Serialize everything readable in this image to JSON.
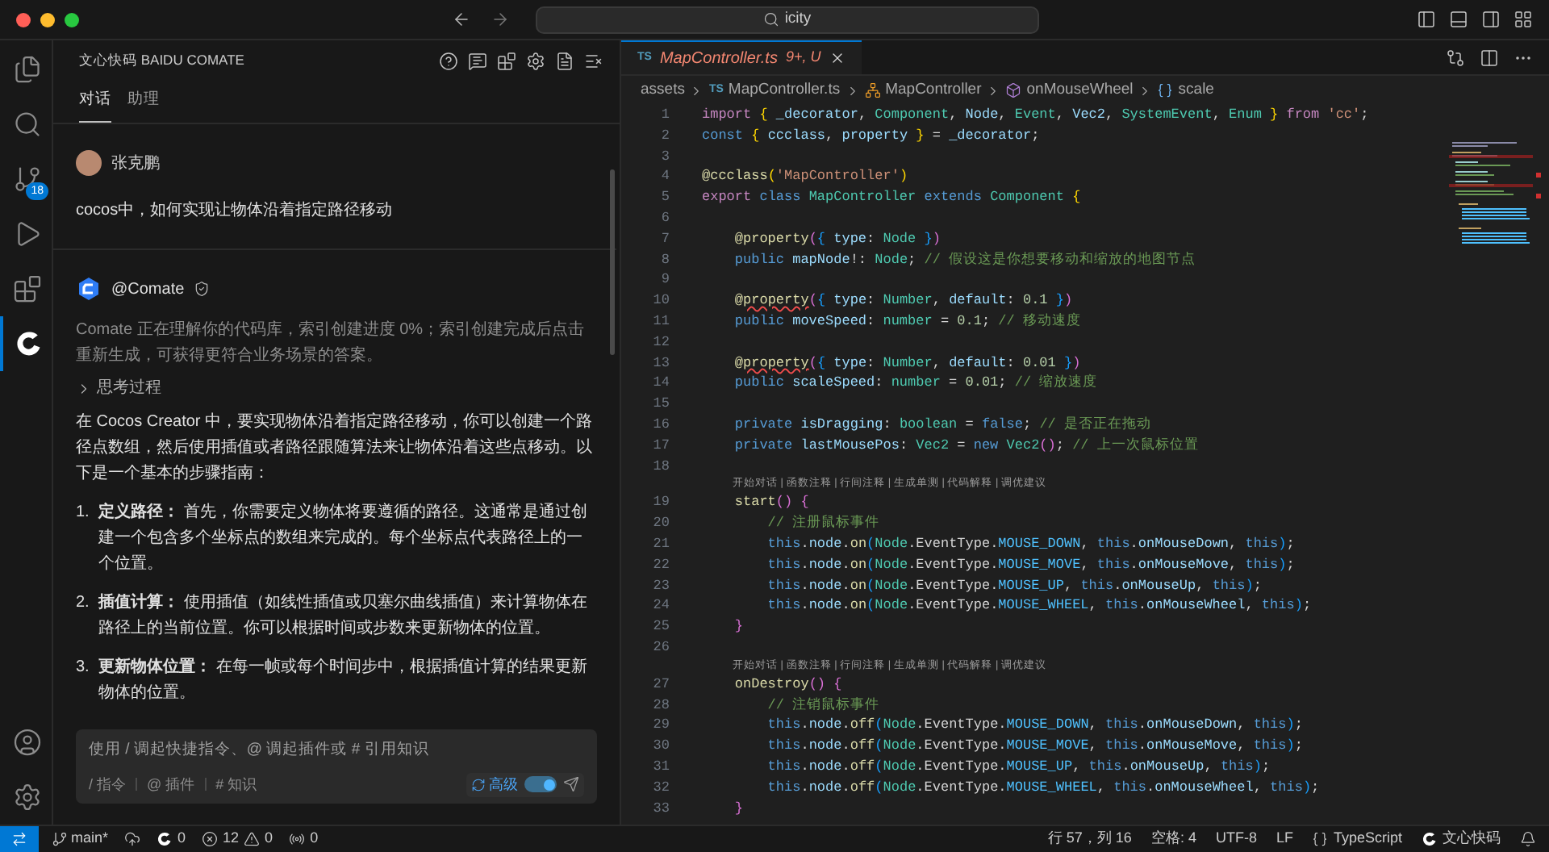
{
  "title_bar": {
    "search": "icity"
  },
  "activity_bar": [
    {
      "kind": "files",
      "selected": false
    },
    {
      "kind": "search",
      "selected": false
    },
    {
      "kind": "source-control",
      "selected": false,
      "badge": "18"
    },
    {
      "kind": "debug",
      "selected": false
    },
    {
      "kind": "extensions",
      "selected": false
    },
    {
      "kind": "comate",
      "selected": true
    }
  ],
  "activity_bottom": [
    {
      "kind": "account"
    },
    {
      "kind": "settings"
    }
  ],
  "chat": {
    "title": "文心快码 BAIDU COMATE",
    "tabs": [
      {
        "label": "对话",
        "selected": true
      },
      {
        "label": "助理",
        "selected": false
      }
    ],
    "user": {
      "name": "张克鹏",
      "message": "cocos中，如何实现让物体沿着指定路径移动"
    },
    "bot": {
      "name": "@Comate",
      "notice": "Comate 正在理解你的代码库，索引创建进度 0%；索引创建完成后点击重新生成，可获得更符合业务场景的答案。",
      "thinking": {
        "label": "思考过程",
        "expanded": false
      },
      "intro": "在 Cocos Creator 中，要实现物体沿着指定路径移动，你可以创建一个路径点数组，然后使用插值或者路径跟随算法来让物体沿着这些点移动。以下是一个基本的步骤指南：",
      "steps": [
        {
          "number": "1.",
          "text": "**定义路径：** 首先，你需要定义物体将要遵循的路径。这通常是通过创建一个包含多个坐标点的数组来完成的。每个坐标点代表路径上的一个位置。"
        },
        {
          "number": "2.",
          "text": "**插值计算：** 使用插值（如线性插值或贝塞尔曲线插值）来计算物体在路径上的当前位置。你可以根据时间或步数来更新物体的位置。"
        },
        {
          "number": "3.",
          "text": "**更新物体位置：** 在每一帧或每个时间步中，根据插值计算的结果更新物体的位置。"
        }
      ]
    },
    "input": {
      "placeholder": "使用 / 调起快捷指令、@ 调起插件或 # 引用知识",
      "chips": [
        "/ 指令",
        "@ 插件",
        "# 知识"
      ],
      "advanced": {
        "label": "高级",
        "on": true
      }
    }
  },
  "editor": {
    "tab": {
      "lang": "TS",
      "name": "MapController.ts",
      "status": "9+, U"
    },
    "breadcrumbs": [
      {
        "kind": "folder",
        "label": "assets"
      },
      {
        "kind": "file",
        "icon": "TS",
        "label": "MapController.ts"
      },
      {
        "kind": "class",
        "label": "MapController"
      },
      {
        "kind": "method",
        "label": "onMouseWheel"
      },
      {
        "kind": "variable",
        "label": "scale"
      }
    ],
    "lines": [
      {
        "kind": "code",
        "number": "1",
        "tokens": [
          {
            "kind": "control",
            "text": "import "
          },
          {
            "kind": "bracket1",
            "text": "{ "
          },
          {
            "kind": "variable",
            "text": "_decorator"
          },
          {
            "kind": "plain",
            "text": ", "
          },
          {
            "kind": "type",
            "text": "Component"
          },
          {
            "kind": "plain",
            "text": ", "
          },
          {
            "kind": "variable",
            "text": "Node"
          },
          {
            "kind": "plain",
            "text": ", "
          },
          {
            "kind": "type",
            "text": "Event"
          },
          {
            "kind": "plain",
            "text": ", "
          },
          {
            "kind": "variable",
            "text": "Vec2"
          },
          {
            "kind": "plain",
            "text": ", "
          },
          {
            "kind": "type",
            "text": "SystemEvent"
          },
          {
            "kind": "plain",
            "text": ", "
          },
          {
            "kind": "type",
            "text": "Enum"
          },
          {
            "kind": "bracket1",
            "text": " }"
          },
          {
            "kind": "control",
            "text": " from "
          },
          {
            "kind": "string",
            "text": "'cc'"
          },
          {
            "kind": "plain",
            "text": ";"
          }
        ]
      },
      {
        "kind": "code",
        "number": "2",
        "tokens": [
          {
            "kind": "keyword",
            "text": "const "
          },
          {
            "kind": "bracket1",
            "text": "{ "
          },
          {
            "kind": "variable",
            "text": "ccclass"
          },
          {
            "kind": "plain",
            "text": ", "
          },
          {
            "kind": "variable",
            "text": "property"
          },
          {
            "kind": "bracket1",
            "text": " }"
          },
          {
            "kind": "plain",
            "text": " = "
          },
          {
            "kind": "variable",
            "text": "_decorator"
          },
          {
            "kind": "plain",
            "text": ";"
          }
        ]
      },
      {
        "kind": "code",
        "number": "3"
      },
      {
        "kind": "code",
        "number": "4",
        "tokens": [
          {
            "kind": "function",
            "text": "@ccclass"
          },
          {
            "kind": "bracket1",
            "text": "("
          },
          {
            "kind": "string",
            "text": "'MapController'"
          },
          {
            "kind": "bracket1",
            "text": ")"
          }
        ]
      },
      {
        "kind": "code",
        "number": "5",
        "tokens": [
          {
            "kind": "control",
            "text": "export "
          },
          {
            "kind": "keyword",
            "text": "class "
          },
          {
            "kind": "type",
            "text": "MapController "
          },
          {
            "kind": "keyword",
            "text": "extends "
          },
          {
            "kind": "type",
            "text": "Component "
          },
          {
            "kind": "bracket1",
            "text": "{"
          }
        ]
      },
      {
        "kind": "code",
        "number": "6"
      },
      {
        "kind": "code",
        "number": "7",
        "tokens": [
          {
            "kind": "function",
            "text": "    @property"
          },
          {
            "kind": "bracket2",
            "text": "("
          },
          {
            "kind": "bracket3",
            "text": "{ "
          },
          {
            "kind": "variable",
            "text": "type"
          },
          {
            "kind": "plain",
            "text": ": "
          },
          {
            "kind": "type",
            "text": "Node"
          },
          {
            "kind": "bracket3",
            "text": " }"
          },
          {
            "kind": "bracket2",
            "text": ")"
          }
        ]
      },
      {
        "kind": "code",
        "number": "8",
        "tokens": [
          {
            "kind": "keyword",
            "text": "    public "
          },
          {
            "kind": "variable",
            "text": "mapNode"
          },
          {
            "kind": "plain",
            "text": "!: "
          },
          {
            "kind": "type",
            "text": "Node"
          },
          {
            "kind": "plain",
            "text": "; "
          },
          {
            "kind": "comment",
            "text": "// 假设这是你想要移动和缩放的地图节点"
          }
        ]
      },
      {
        "kind": "code",
        "number": "9"
      },
      {
        "kind": "code",
        "number": "10",
        "tokens": [
          {
            "kind": "function",
            "text": "    @"
          },
          {
            "kind": "function-error",
            "text": "property"
          },
          {
            "kind": "bracket2",
            "text": "("
          },
          {
            "kind": "bracket3",
            "text": "{ "
          },
          {
            "kind": "variable",
            "text": "type"
          },
          {
            "kind": "plain",
            "text": ": "
          },
          {
            "kind": "type",
            "text": "Number"
          },
          {
            "kind": "plain",
            "text": ", "
          },
          {
            "kind": "variable",
            "text": "default"
          },
          {
            "kind": "plain",
            "text": ": "
          },
          {
            "kind": "number",
            "text": "0.1"
          },
          {
            "kind": "bracket3",
            "text": " }"
          },
          {
            "kind": "bracket2",
            "text": ")"
          }
        ]
      },
      {
        "kind": "code",
        "number": "11",
        "tokens": [
          {
            "kind": "keyword",
            "text": "    public "
          },
          {
            "kind": "variable",
            "text": "moveSpeed"
          },
          {
            "kind": "plain",
            "text": ": "
          },
          {
            "kind": "type",
            "text": "number"
          },
          {
            "kind": "plain",
            "text": " = "
          },
          {
            "kind": "number",
            "text": "0.1"
          },
          {
            "kind": "plain",
            "text": "; "
          },
          {
            "kind": "comment",
            "text": "// 移动速度"
          }
        ]
      },
      {
        "kind": "code",
        "number": "12"
      },
      {
        "kind": "code",
        "number": "13",
        "tokens": [
          {
            "kind": "function",
            "text": "    @"
          },
          {
            "kind": "function-error",
            "text": "property"
          },
          {
            "kind": "bracket2",
            "text": "("
          },
          {
            "kind": "bracket3",
            "text": "{ "
          },
          {
            "kind": "variable",
            "text": "type"
          },
          {
            "kind": "plain",
            "text": ": "
          },
          {
            "kind": "type",
            "text": "Number"
          },
          {
            "kind": "plain",
            "text": ", "
          },
          {
            "kind": "variable",
            "text": "default"
          },
          {
            "kind": "plain",
            "text": ": "
          },
          {
            "kind": "number",
            "text": "0.01"
          },
          {
            "kind": "bracket3",
            "text": " }"
          },
          {
            "kind": "bracket2",
            "text": ")"
          }
        ]
      },
      {
        "kind": "code",
        "number": "14",
        "tokens": [
          {
            "kind": "keyword",
            "text": "    public "
          },
          {
            "kind": "variable",
            "text": "scaleSpeed"
          },
          {
            "kind": "plain",
            "text": ": "
          },
          {
            "kind": "type",
            "text": "number"
          },
          {
            "kind": "plain",
            "text": " = "
          },
          {
            "kind": "number",
            "text": "0.01"
          },
          {
            "kind": "plain",
            "text": "; "
          },
          {
            "kind": "comment",
            "text": "// 缩放速度"
          }
        ]
      },
      {
        "kind": "code",
        "number": "15"
      },
      {
        "kind": "code",
        "number": "16",
        "tokens": [
          {
            "kind": "keyword",
            "text": "    private "
          },
          {
            "kind": "variable",
            "text": "isDragging"
          },
          {
            "kind": "plain",
            "text": ": "
          },
          {
            "kind": "type",
            "text": "boolean"
          },
          {
            "kind": "plain",
            "text": " = "
          },
          {
            "kind": "keyword",
            "text": "false"
          },
          {
            "kind": "plain",
            "text": "; "
          },
          {
            "kind": "comment",
            "text": "// 是否正在拖动"
          }
        ]
      },
      {
        "kind": "code",
        "number": "17",
        "tokens": [
          {
            "kind": "keyword",
            "text": "    private "
          },
          {
            "kind": "variable",
            "text": "lastMousePos"
          },
          {
            "kind": "plain",
            "text": ": "
          },
          {
            "kind": "type",
            "text": "Vec2"
          },
          {
            "kind": "plain",
            "text": " = "
          },
          {
            "kind": "keyword",
            "text": "new "
          },
          {
            "kind": "type",
            "text": "Vec2"
          },
          {
            "kind": "bracket2",
            "text": "()"
          },
          {
            "kind": "plain",
            "text": "; "
          },
          {
            "kind": "comment",
            "text": "// 上一次鼠标位置"
          }
        ]
      },
      {
        "kind": "code",
        "number": "18"
      },
      {
        "kind": "codelens",
        "text": "开始对话 | 函数注释 | 行间注释 | 生成单测 | 代码解释 | 调优建议"
      },
      {
        "kind": "code",
        "number": "19",
        "tokens": [
          {
            "kind": "function",
            "text": "    start"
          },
          {
            "kind": "bracket2",
            "text": "() {"
          }
        ]
      },
      {
        "kind": "code",
        "number": "20",
        "tokens": [
          {
            "kind": "comment",
            "text": "        // 注册鼠标事件"
          }
        ]
      },
      {
        "kind": "code",
        "number": "21",
        "tokens": [
          {
            "kind": "keyword",
            "text": "        this"
          },
          {
            "kind": "plain",
            "text": "."
          },
          {
            "kind": "variable",
            "text": "node"
          },
          {
            "kind": "plain",
            "text": "."
          },
          {
            "kind": "function",
            "text": "on"
          },
          {
            "kind": "bracket3",
            "text": "("
          },
          {
            "kind": "type",
            "text": "Node"
          },
          {
            "kind": "plain",
            "text": ".EventType."
          },
          {
            "kind": "constant",
            "text": "MOUSE_DOWN"
          },
          {
            "kind": "plain",
            "text": ", "
          },
          {
            "kind": "keyword",
            "text": "this"
          },
          {
            "kind": "plain",
            "text": "."
          },
          {
            "kind": "variable",
            "text": "onMouseDown"
          },
          {
            "kind": "plain",
            "text": ", "
          },
          {
            "kind": "keyword",
            "text": "this"
          },
          {
            "kind": "bracket3",
            "text": ")"
          },
          {
            "kind": "plain",
            "text": ";"
          }
        ]
      },
      {
        "kind": "code",
        "number": "22",
        "tokens": [
          {
            "kind": "keyword",
            "text": "        this"
          },
          {
            "kind": "plain",
            "text": "."
          },
          {
            "kind": "variable",
            "text": "node"
          },
          {
            "kind": "plain",
            "text": "."
          },
          {
            "kind": "function",
            "text": "on"
          },
          {
            "kind": "bracket3",
            "text": "("
          },
          {
            "kind": "type",
            "text": "Node"
          },
          {
            "kind": "plain",
            "text": ".EventType."
          },
          {
            "kind": "constant",
            "text": "MOUSE_MOVE"
          },
          {
            "kind": "plain",
            "text": ", "
          },
          {
            "kind": "keyword",
            "text": "this"
          },
          {
            "kind": "plain",
            "text": "."
          },
          {
            "kind": "variable",
            "text": "onMouseMove"
          },
          {
            "kind": "plain",
            "text": ", "
          },
          {
            "kind": "keyword",
            "text": "this"
          },
          {
            "kind": "bracket3",
            "text": ")"
          },
          {
            "kind": "plain",
            "text": ";"
          }
        ]
      },
      {
        "kind": "code",
        "number": "23",
        "tokens": [
          {
            "kind": "keyword",
            "text": "        this"
          },
          {
            "kind": "plain",
            "text": "."
          },
          {
            "kind": "variable",
            "text": "node"
          },
          {
            "kind": "plain",
            "text": "."
          },
          {
            "kind": "function",
            "text": "on"
          },
          {
            "kind": "bracket3",
            "text": "("
          },
          {
            "kind": "type",
            "text": "Node"
          },
          {
            "kind": "plain",
            "text": ".EventType."
          },
          {
            "kind": "constant",
            "text": "MOUSE_UP"
          },
          {
            "kind": "plain",
            "text": ", "
          },
          {
            "kind": "keyword",
            "text": "this"
          },
          {
            "kind": "plain",
            "text": "."
          },
          {
            "kind": "variable",
            "text": "onMouseUp"
          },
          {
            "kind": "plain",
            "text": ", "
          },
          {
            "kind": "keyword",
            "text": "this"
          },
          {
            "kind": "bracket3",
            "text": ")"
          },
          {
            "kind": "plain",
            "text": ";"
          }
        ]
      },
      {
        "kind": "code",
        "number": "24",
        "tokens": [
          {
            "kind": "keyword",
            "text": "        this"
          },
          {
            "kind": "plain",
            "text": "."
          },
          {
            "kind": "variable",
            "text": "node"
          },
          {
            "kind": "plain",
            "text": "."
          },
          {
            "kind": "function",
            "text": "on"
          },
          {
            "kind": "bracket3",
            "text": "("
          },
          {
            "kind": "type",
            "text": "Node"
          },
          {
            "kind": "plain",
            "text": ".EventType."
          },
          {
            "kind": "constant",
            "text": "MOUSE_WHEEL"
          },
          {
            "kind": "plain",
            "text": ", "
          },
          {
            "kind": "keyword",
            "text": "this"
          },
          {
            "kind": "plain",
            "text": "."
          },
          {
            "kind": "variable",
            "text": "onMouseWheel"
          },
          {
            "kind": "plain",
            "text": ", "
          },
          {
            "kind": "keyword",
            "text": "this"
          },
          {
            "kind": "bracket3",
            "text": ")"
          },
          {
            "kind": "plain",
            "text": ";"
          }
        ]
      },
      {
        "kind": "code",
        "number": "25",
        "tokens": [
          {
            "kind": "bracket2",
            "text": "    }"
          }
        ]
      },
      {
        "kind": "code",
        "number": "26"
      },
      {
        "kind": "codelens",
        "text": "开始对话 | 函数注释 | 行间注释 | 生成单测 | 代码解释 | 调优建议"
      },
      {
        "kind": "code",
        "number": "27",
        "tokens": [
          {
            "kind": "function",
            "text": "    onDestroy"
          },
          {
            "kind": "bracket2",
            "text": "() {"
          }
        ]
      },
      {
        "kind": "code",
        "number": "28",
        "tokens": [
          {
            "kind": "comment",
            "text": "        // 注销鼠标事件"
          }
        ]
      },
      {
        "kind": "code",
        "number": "29",
        "tokens": [
          {
            "kind": "keyword",
            "text": "        this"
          },
          {
            "kind": "plain",
            "text": "."
          },
          {
            "kind": "variable",
            "text": "node"
          },
          {
            "kind": "plain",
            "text": "."
          },
          {
            "kind": "function",
            "text": "off"
          },
          {
            "kind": "bracket3",
            "text": "("
          },
          {
            "kind": "type",
            "text": "Node"
          },
          {
            "kind": "plain",
            "text": ".EventType."
          },
          {
            "kind": "constant",
            "text": "MOUSE_DOWN"
          },
          {
            "kind": "plain",
            "text": ", "
          },
          {
            "kind": "keyword",
            "text": "this"
          },
          {
            "kind": "plain",
            "text": "."
          },
          {
            "kind": "variable",
            "text": "onMouseDown"
          },
          {
            "kind": "plain",
            "text": ", "
          },
          {
            "kind": "keyword",
            "text": "this"
          },
          {
            "kind": "bracket3",
            "text": ")"
          },
          {
            "kind": "plain",
            "text": ";"
          }
        ]
      },
      {
        "kind": "code",
        "number": "30",
        "tokens": [
          {
            "kind": "keyword",
            "text": "        this"
          },
          {
            "kind": "plain",
            "text": "."
          },
          {
            "kind": "variable",
            "text": "node"
          },
          {
            "kind": "plain",
            "text": "."
          },
          {
            "kind": "function",
            "text": "off"
          },
          {
            "kind": "bracket3",
            "text": "("
          },
          {
            "kind": "type",
            "text": "Node"
          },
          {
            "kind": "plain",
            "text": ".EventType."
          },
          {
            "kind": "constant",
            "text": "MOUSE_MOVE"
          },
          {
            "kind": "plain",
            "text": ", "
          },
          {
            "kind": "keyword",
            "text": "this"
          },
          {
            "kind": "plain",
            "text": "."
          },
          {
            "kind": "variable",
            "text": "onMouseMove"
          },
          {
            "kind": "plain",
            "text": ", "
          },
          {
            "kind": "keyword",
            "text": "this"
          },
          {
            "kind": "bracket3",
            "text": ")"
          },
          {
            "kind": "plain",
            "text": ";"
          }
        ]
      },
      {
        "kind": "code",
        "number": "31",
        "tokens": [
          {
            "kind": "keyword",
            "text": "        this"
          },
          {
            "kind": "plain",
            "text": "."
          },
          {
            "kind": "variable",
            "text": "node"
          },
          {
            "kind": "plain",
            "text": "."
          },
          {
            "kind": "function",
            "text": "off"
          },
          {
            "kind": "bracket3",
            "text": "("
          },
          {
            "kind": "type",
            "text": "Node"
          },
          {
            "kind": "plain",
            "text": ".EventType."
          },
          {
            "kind": "constant",
            "text": "MOUSE_UP"
          },
          {
            "kind": "plain",
            "text": ", "
          },
          {
            "kind": "keyword",
            "text": "this"
          },
          {
            "kind": "plain",
            "text": "."
          },
          {
            "kind": "variable",
            "text": "onMouseUp"
          },
          {
            "kind": "plain",
            "text": ", "
          },
          {
            "kind": "keyword",
            "text": "this"
          },
          {
            "kind": "bracket3",
            "text": ")"
          },
          {
            "kind": "plain",
            "text": ";"
          }
        ]
      },
      {
        "kind": "code",
        "number": "32",
        "tokens": [
          {
            "kind": "keyword",
            "text": "        this"
          },
          {
            "kind": "plain",
            "text": "."
          },
          {
            "kind": "variable",
            "text": "node"
          },
          {
            "kind": "plain",
            "text": "."
          },
          {
            "kind": "function",
            "text": "off"
          },
          {
            "kind": "bracket3",
            "text": "("
          },
          {
            "kind": "type",
            "text": "Node"
          },
          {
            "kind": "plain",
            "text": ".EventType."
          },
          {
            "kind": "constant",
            "text": "MOUSE_WHEEL"
          },
          {
            "kind": "plain",
            "text": ", "
          },
          {
            "kind": "keyword",
            "text": "this"
          },
          {
            "kind": "plain",
            "text": "."
          },
          {
            "kind": "variable",
            "text": "onMouseWheel"
          },
          {
            "kind": "plain",
            "text": ", "
          },
          {
            "kind": "keyword",
            "text": "this"
          },
          {
            "kind": "bracket3",
            "text": ")"
          },
          {
            "kind": "plain",
            "text": ";"
          }
        ]
      },
      {
        "kind": "code",
        "number": "33",
        "tokens": [
          {
            "kind": "bracket2",
            "text": "    }"
          }
        ]
      }
    ]
  },
  "status_bar": {
    "branch": "main*",
    "comate_count": "0",
    "errors": "12",
    "warnings": "0",
    "ports": "0",
    "position": "行 57，列 16",
    "indent": "空格: 4",
    "encoding": "UTF-8",
    "eol": "LF",
    "language": "TypeScript",
    "assistant": "文心快码"
  }
}
